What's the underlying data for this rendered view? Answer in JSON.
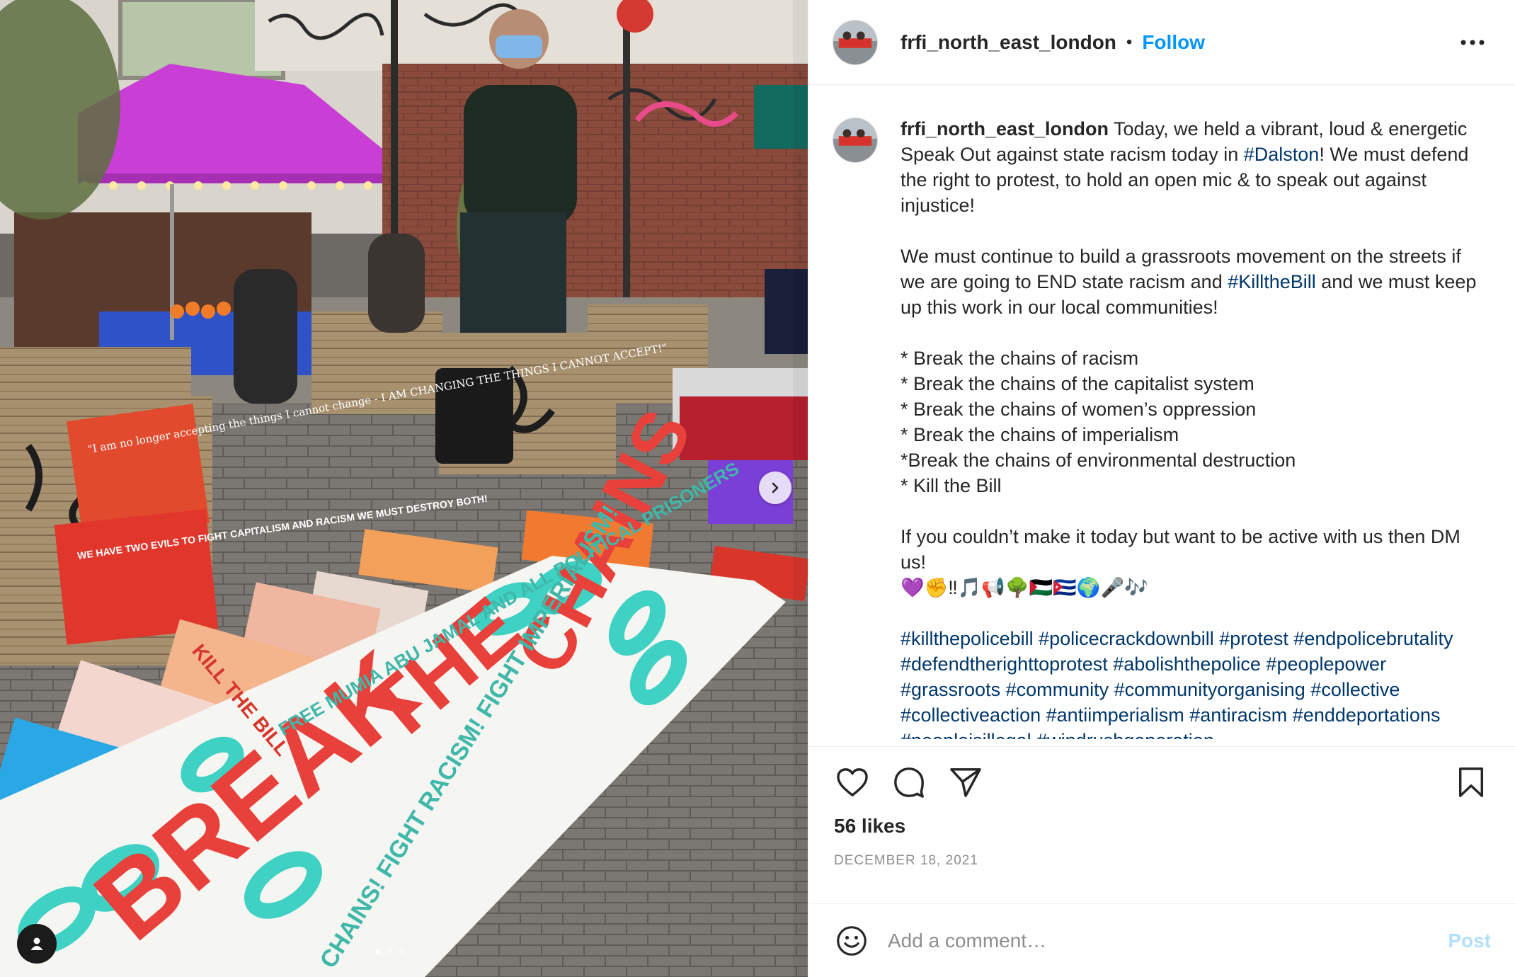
{
  "media": {
    "photo_texts": {
      "banner_break": "BREAK",
      "banner_the": "THE",
      "banner_chains": "CHAINS",
      "banner_slogan_top": "FREE MUMIA ABU JAMAL AND ALL POLITICAL PRISONERS",
      "banner_slogan_bottom": "CHAINS! FIGHT RACISM! FIGHT IMPERIALISM!",
      "sign_quote": "\"I am no longer accepting the things I cannot change - I AM CHANGING THE THINGS I CANNOT ACCEPT!\"",
      "sign_evils": "WE HAVE TWO EVILS TO FIGHT CAPITALISM AND RACISM WE MUST DESTROY BOTH!",
      "sign_kill_the_bill": "KILL THE BILL"
    },
    "carousel": {
      "count": 3,
      "active_index": 0
    },
    "next_icon": "chevron-right-icon",
    "tag_icon": "user-tag-icon"
  },
  "header": {
    "username": "frfi_north_east_london",
    "bullet": "•",
    "follow_label": "Follow",
    "more_icon": "more-dots-icon"
  },
  "caption": {
    "username": "frfi_north_east_london",
    "paragraphs": [
      [
        {
          "t": " Today, we held a vibrant, loud & energetic Speak Out against state racism today in "
        },
        {
          "t": "#Dalston",
          "tag": true
        },
        {
          "t": "! We must defend the right to protest, to hold an open mic & to speak out against injustice!"
        }
      ],
      [
        {
          "t": "We must continue to build a grassroots movement on the streets if we are going to END state racism and "
        },
        {
          "t": "#KilltheBill",
          "tag": true
        },
        {
          "t": " and we must keep up this work in our local communities!"
        }
      ],
      [
        {
          "t": "* Break the chains of racism\n* Break the chains of the capitalist system\n* Break the chains of women’s oppression\n* Break the chains of imperialism\n*Break the chains of environmental destruction\n* Kill the Bill"
        }
      ],
      [
        {
          "t": "If you couldn’t make it today but want to be active with us then DM us!\n💜✊‼🎵📢🌳🇵🇸🇨🇺🌍🎤🎶"
        }
      ],
      [
        {
          "t": "#killthepolicebill",
          "tag": true
        },
        {
          "t": " "
        },
        {
          "t": "#policecrackdownbill",
          "tag": true
        },
        {
          "t": " "
        },
        {
          "t": "#protest",
          "tag": true
        },
        {
          "t": " "
        },
        {
          "t": "#endpolicebrutality",
          "tag": true
        },
        {
          "t": " "
        },
        {
          "t": "#defendtherighttoprotest",
          "tag": true
        },
        {
          "t": " "
        },
        {
          "t": "#abolishthepolice",
          "tag": true
        },
        {
          "t": " "
        },
        {
          "t": "#peoplepower",
          "tag": true
        },
        {
          "t": " "
        },
        {
          "t": "#grassroots",
          "tag": true
        },
        {
          "t": " "
        },
        {
          "t": "#community",
          "tag": true
        },
        {
          "t": " "
        },
        {
          "t": "#communityorganising",
          "tag": true
        },
        {
          "t": " "
        },
        {
          "t": "#collective",
          "tag": true
        },
        {
          "t": " "
        },
        {
          "t": "#collectiveaction",
          "tag": true
        },
        {
          "t": " "
        },
        {
          "t": "#antiimperialism",
          "tag": true
        },
        {
          "t": " "
        },
        {
          "t": "#antiracism",
          "tag": true
        },
        {
          "t": " "
        },
        {
          "t": "#enddeportations",
          "tag": true
        },
        {
          "t": " "
        },
        {
          "t": "#peopleisillegal",
          "tag": true
        },
        {
          "t": " "
        },
        {
          "t": "#windrushgeneration",
          "tag": true
        }
      ]
    ]
  },
  "actions": {
    "like_icon": "heart-icon",
    "comment_icon": "comment-bubble-icon",
    "share_icon": "paper-plane-icon",
    "save_icon": "bookmark-icon",
    "likes_text": "56 likes",
    "date": "DECEMBER 18, 2021"
  },
  "comment": {
    "emoji_icon": "smiley-icon",
    "placeholder": "Add a comment…",
    "post_label": "Post"
  },
  "colors": {
    "link_blue": "#0095f6",
    "hashtag_blue": "#00376b",
    "post_disabled": "#b2dffc",
    "muted": "#8e8e8e",
    "gazebo_magenta": "#c93fd6",
    "banner_red": "#e8403a",
    "banner_teal": "#3fd1c3"
  }
}
